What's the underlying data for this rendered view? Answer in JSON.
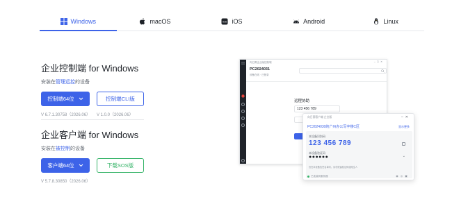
{
  "tabs": [
    {
      "label": "Windows",
      "icon": "windows-icon",
      "active": true
    },
    {
      "label": "macOS",
      "icon": "apple-icon",
      "active": false
    },
    {
      "label": "iOS",
      "icon": "ios-icon",
      "active": false
    },
    {
      "label": "Android",
      "icon": "android-icon",
      "active": false
    },
    {
      "label": "Linux",
      "icon": "linux-icon",
      "active": false
    }
  ],
  "controller": {
    "title": "企业控制端 for Windows",
    "subtitle_prefix": "安装在",
    "subtitle_link": "管理远控",
    "subtitle_suffix": "的设备",
    "primary_label": "控制端64位",
    "secondary_label": "控制端CLI版",
    "primary_version": "V 6.7.1.30758（2026.06）",
    "secondary_version": "V 1.0.0（2026.06）"
  },
  "client": {
    "title": "企业客户端 for Windows",
    "subtitle_prefix": "安装在",
    "subtitle_link": "被控制",
    "subtitle_suffix": "的设备",
    "primary_label": "客户端64位",
    "secondary_label": "下载SOS版",
    "primary_version": "V 5.7.8.30850（2026.06）"
  },
  "mock_app": {
    "window_title": "向日葵企业版控制端",
    "device_name": "PC2024031",
    "status_text": "设备在线 · 已登录",
    "remote_title": "远程协助",
    "id_value": "123 456 789"
  },
  "mock_panel": {
    "title": "向日葵客户端 企业版",
    "device_name": "PC2024030的广州办公写字楼C区",
    "link": "显示更多",
    "id_label": "本设备识别码",
    "code": "123 456 789",
    "pass_label": "本设备验证码",
    "dots": "●●●●●●",
    "note": "仅在本设备信任名单内，请勿泄露验证码给陌生人",
    "footer": "已连接到服务器"
  },
  "colors": {
    "accent": "#3d63e8",
    "green": "#34b367",
    "text": "#1f2329",
    "muted": "#8f959e"
  }
}
